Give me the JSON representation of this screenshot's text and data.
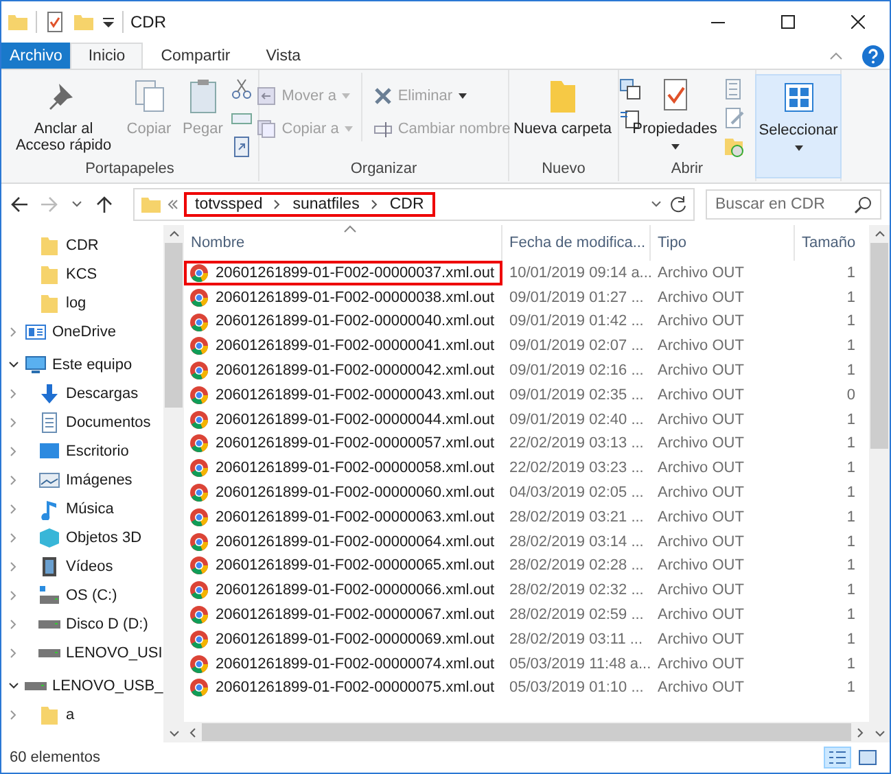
{
  "window": {
    "title": "CDR"
  },
  "ribbon_tabs": [
    {
      "label": "Archivo",
      "kind": "file",
      "selected": false
    },
    {
      "label": "Inicio",
      "kind": "tab",
      "selected": true
    },
    {
      "label": "Compartir",
      "kind": "tab",
      "selected": false
    },
    {
      "label": "Vista",
      "kind": "tab",
      "selected": false
    }
  ],
  "ribbon_groups": [
    {
      "label": "Portapapeles",
      "buttons": [
        {
          "label": "Anclar al Acceso rápido",
          "disabled": false
        },
        {
          "label": "Copiar",
          "disabled": true
        },
        {
          "label": "Pegar",
          "disabled": true
        }
      ]
    },
    {
      "label": "Organizar",
      "buttons": [
        {
          "label": "Mover a",
          "disabled": true
        },
        {
          "label": "Copiar a",
          "disabled": true
        },
        {
          "label": "Eliminar",
          "disabled": true
        },
        {
          "label": "Cambiar nombre",
          "disabled": true
        }
      ]
    },
    {
      "label": "Nuevo",
      "buttons": [
        {
          "label": "Nueva carpeta",
          "disabled": false
        }
      ]
    },
    {
      "label": "Abrir",
      "buttons": [
        {
          "label": "Propiedades",
          "disabled": false
        }
      ]
    },
    {
      "buttons": [
        {
          "label": "Seleccionar",
          "disabled": false,
          "selected": true
        }
      ]
    }
  ],
  "address_bar": {
    "segments": [
      "totvssped",
      "sunatfiles",
      "CDR"
    ],
    "highlighted": true
  },
  "search": {
    "placeholder": "Buscar en CDR"
  },
  "sidebar": {
    "pinned_folders": [
      {
        "label": "CDR"
      },
      {
        "label": "KCS"
      },
      {
        "label": "log"
      }
    ],
    "items": [
      {
        "label": "OneDrive",
        "kind": "cloud",
        "expanded": false
      },
      {
        "label": "Este equipo",
        "kind": "pc",
        "expanded": true,
        "children": [
          {
            "label": "Descargas",
            "kind": "download",
            "expanded": false
          },
          {
            "label": "Documentos",
            "kind": "document",
            "expanded": false
          },
          {
            "label": "Escritorio",
            "kind": "desktop",
            "expanded": false
          },
          {
            "label": "Imágenes",
            "kind": "picture",
            "expanded": false
          },
          {
            "label": "Música",
            "kind": "music",
            "expanded": false
          },
          {
            "label": "Objetos 3D",
            "kind": "cube",
            "expanded": false
          },
          {
            "label": "Vídeos",
            "kind": "video",
            "expanded": false
          },
          {
            "label": "OS (C:)",
            "kind": "osdrive",
            "expanded": false
          },
          {
            "label": "Disco D (D:)",
            "kind": "drive",
            "expanded": false
          },
          {
            "label": "LENOVO_USI",
            "kind": "drive",
            "expanded": false
          }
        ]
      },
      {
        "label": "LENOVO_USB_",
        "kind": "drive",
        "expanded": true,
        "children": [
          {
            "label": "a",
            "kind": "folder",
            "expanded": false
          }
        ]
      }
    ]
  },
  "table": {
    "columns": [
      {
        "label": "Nombre",
        "sorted": true
      },
      {
        "label": "Fecha de modifica...",
        "sorted": false
      },
      {
        "label": "Tipo",
        "sorted": false
      },
      {
        "label": "Tamaño",
        "sorted": false
      }
    ],
    "rows": [
      {
        "name": "20601261899-01-F002-00000037.xml.out",
        "date": "10/01/2019 09:14 a...",
        "type": "Archivo OUT",
        "size": "1",
        "highlighted": true
      },
      {
        "name": "20601261899-01-F002-00000038.xml.out",
        "date": "09/01/2019 01:27 ...",
        "type": "Archivo OUT",
        "size": "1",
        "highlighted": false
      },
      {
        "name": "20601261899-01-F002-00000040.xml.out",
        "date": "09/01/2019 01:42 ...",
        "type": "Archivo OUT",
        "size": "1",
        "highlighted": false
      },
      {
        "name": "20601261899-01-F002-00000041.xml.out",
        "date": "09/01/2019 02:07 ...",
        "type": "Archivo OUT",
        "size": "1",
        "highlighted": false
      },
      {
        "name": "20601261899-01-F002-00000042.xml.out",
        "date": "09/01/2019 02:16 ...",
        "type": "Archivo OUT",
        "size": "1",
        "highlighted": false
      },
      {
        "name": "20601261899-01-F002-00000043.xml.out",
        "date": "09/01/2019 02:35 ...",
        "type": "Archivo OUT",
        "size": "0",
        "highlighted": false
      },
      {
        "name": "20601261899-01-F002-00000044.xml.out",
        "date": "09/01/2019 02:40 ...",
        "type": "Archivo OUT",
        "size": "1",
        "highlighted": false
      },
      {
        "name": "20601261899-01-F002-00000057.xml.out",
        "date": "22/02/2019 03:13 ...",
        "type": "Archivo OUT",
        "size": "1",
        "highlighted": false
      },
      {
        "name": "20601261899-01-F002-00000058.xml.out",
        "date": "22/02/2019 03:23 ...",
        "type": "Archivo OUT",
        "size": "1",
        "highlighted": false
      },
      {
        "name": "20601261899-01-F002-00000060.xml.out",
        "date": "04/03/2019 02:05 ...",
        "type": "Archivo OUT",
        "size": "1",
        "highlighted": false
      },
      {
        "name": "20601261899-01-F002-00000063.xml.out",
        "date": "28/02/2019 03:21 ...",
        "type": "Archivo OUT",
        "size": "1",
        "highlighted": false
      },
      {
        "name": "20601261899-01-F002-00000064.xml.out",
        "date": "28/02/2019 03:14 ...",
        "type": "Archivo OUT",
        "size": "1",
        "highlighted": false
      },
      {
        "name": "20601261899-01-F002-00000065.xml.out",
        "date": "28/02/2019 02:28 ...",
        "type": "Archivo OUT",
        "size": "1",
        "highlighted": false
      },
      {
        "name": "20601261899-01-F002-00000066.xml.out",
        "date": "28/02/2019 02:32 ...",
        "type": "Archivo OUT",
        "size": "1",
        "highlighted": false
      },
      {
        "name": "20601261899-01-F002-00000067.xml.out",
        "date": "28/02/2019 02:59 ...",
        "type": "Archivo OUT",
        "size": "1",
        "highlighted": false
      },
      {
        "name": "20601261899-01-F002-00000069.xml.out",
        "date": "28/02/2019 03:11 ...",
        "type": "Archivo OUT",
        "size": "1",
        "highlighted": false
      },
      {
        "name": "20601261899-01-F002-00000074.xml.out",
        "date": "05/03/2019 11:48 a...",
        "type": "Archivo OUT",
        "size": "1",
        "highlighted": false
      },
      {
        "name": "20601261899-01-F002-00000075.xml.out",
        "date": "05/03/2019 01:10 ...",
        "type": "Archivo OUT",
        "size": "1",
        "highlighted": false
      }
    ]
  },
  "status_bar": {
    "text": "60 elementos",
    "views": [
      {
        "kind": "details",
        "selected": true
      },
      {
        "kind": "thumbnails",
        "selected": false
      }
    ]
  }
}
